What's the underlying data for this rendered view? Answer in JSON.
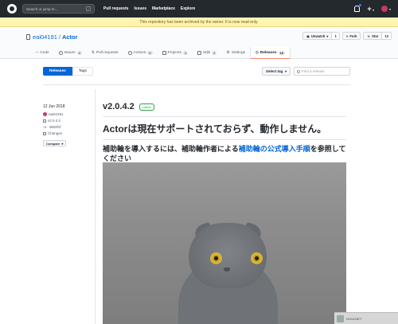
{
  "topnav": {
    "search_placeholder": "Search or jump to...",
    "search_key": "/",
    "links": [
      "Pull requests",
      "Issues",
      "Marketplace",
      "Explore"
    ],
    "plus": "+",
    "caret": "▾"
  },
  "banner": {
    "text": "This repository has been archived by the owner. It is now read-only."
  },
  "repo": {
    "owner": "eai04191",
    "separator": "/",
    "name": "Actor",
    "unwatch": "Unwatch",
    "unwatch_count": "1",
    "fork": "Fork",
    "star": "Star",
    "star_count": "13"
  },
  "tabs": [
    {
      "label": "Code",
      "count": ""
    },
    {
      "label": "Issues",
      "count": "4"
    },
    {
      "label": "Pull requests",
      "count": ""
    },
    {
      "label": "Actions",
      "count": "0"
    },
    {
      "label": "Projects",
      "count": "1"
    },
    {
      "label": "Wiki",
      "count": "2"
    },
    {
      "label": "Settings",
      "count": ""
    },
    {
      "label": "Releases",
      "count": "10"
    }
  ],
  "subnav": {
    "releases": "Releases",
    "tags": "Tags",
    "select_tag": "Select tag",
    "find_placeholder": "Find a release"
  },
  "release_meta": {
    "date": "12 Jun 2018",
    "author": "eai04191",
    "tag": "v2.0.4.2",
    "commit": "4983f1f",
    "changes": "Changes",
    "compare": "Compare"
  },
  "release": {
    "title": "v2.0.4.2",
    "badge": "Latest",
    "heading": "Actorは現在サポートされておらず、動作しません。",
    "body_prefix": "補助輪を導入するには、補助輪作者による",
    "body_link": "補助輪の公式導入手順",
    "body_suffix": "を参照してください"
  },
  "toast": {
    "text": "GOULNET"
  },
  "colors": {
    "header_bg": "#24292e",
    "accent": "#0366d6",
    "banner_bg": "#fff5b1",
    "active_tab_border": "#f9826c",
    "latest_green": "#28a745"
  }
}
